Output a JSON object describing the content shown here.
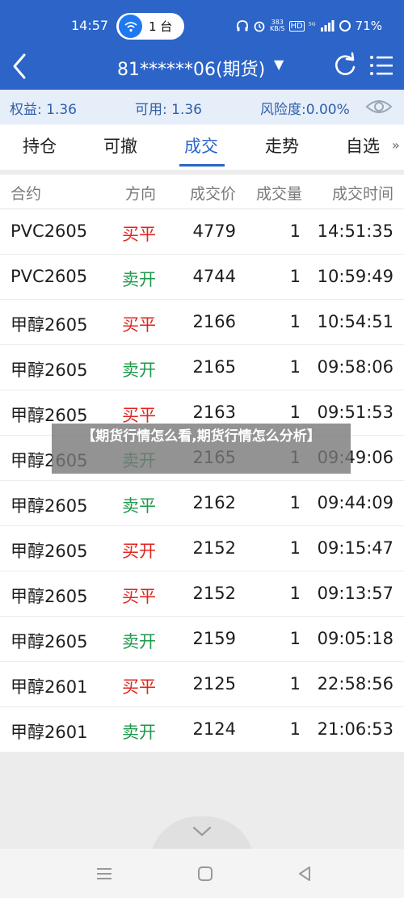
{
  "status_bar": {
    "time": "14:57",
    "pill_label": "1 台",
    "net_speed": "383\nKB/S",
    "hd": "HD",
    "signal": "⁵ᴳ",
    "battery": "71%"
  },
  "header": {
    "title": "81******06(期货)"
  },
  "account": {
    "equity": "权益: 1.36",
    "available": "可用: 1.36",
    "risk": "风险度:0.00%"
  },
  "tabs": [
    {
      "label": "持仓"
    },
    {
      "label": "可撤"
    },
    {
      "label": "成交"
    },
    {
      "label": "走势"
    },
    {
      "label": "自选"
    }
  ],
  "table": {
    "headers": [
      "合约",
      "方向",
      "成交价",
      "成交量",
      "成交时间"
    ],
    "rows": [
      {
        "contract": "PVC2605",
        "direction": "买平",
        "price": "4779",
        "qty": "1",
        "time": "14:51:35"
      },
      {
        "contract": "PVC2605",
        "direction": "卖开",
        "price": "4744",
        "qty": "1",
        "time": "10:59:49"
      },
      {
        "contract": "甲醇2605",
        "direction": "买平",
        "price": "2166",
        "qty": "1",
        "time": "10:54:51"
      },
      {
        "contract": "甲醇2605",
        "direction": "卖开",
        "price": "2165",
        "qty": "1",
        "time": "09:58:06"
      },
      {
        "contract": "甲醇2605",
        "direction": "买平",
        "price": "2163",
        "qty": "1",
        "time": "09:51:53"
      },
      {
        "contract": "甲醇2605",
        "direction": "卖开",
        "price": "2165",
        "qty": "1",
        "time": "09:49:06"
      },
      {
        "contract": "甲醇2605",
        "direction": "卖平",
        "price": "2162",
        "qty": "1",
        "time": "09:44:09"
      },
      {
        "contract": "甲醇2605",
        "direction": "买开",
        "price": "2152",
        "qty": "1",
        "time": "09:15:47"
      },
      {
        "contract": "甲醇2605",
        "direction": "买平",
        "price": "2152",
        "qty": "1",
        "time": "09:13:57"
      },
      {
        "contract": "甲醇2605",
        "direction": "卖开",
        "price": "2159",
        "qty": "1",
        "time": "09:05:18"
      },
      {
        "contract": "甲醇2601",
        "direction": "买平",
        "price": "2125",
        "qty": "1",
        "time": "22:58:56"
      },
      {
        "contract": "甲醇2601",
        "direction": "卖开",
        "price": "2124",
        "qty": "1",
        "time": "21:06:53"
      }
    ]
  },
  "overlay": {
    "caption": "【期货行情怎么看,期货行情怎么分析】"
  },
  "colors": {
    "primary": "#2c64c8",
    "buy": "#e0251f",
    "sell": "#1d9a4a"
  }
}
